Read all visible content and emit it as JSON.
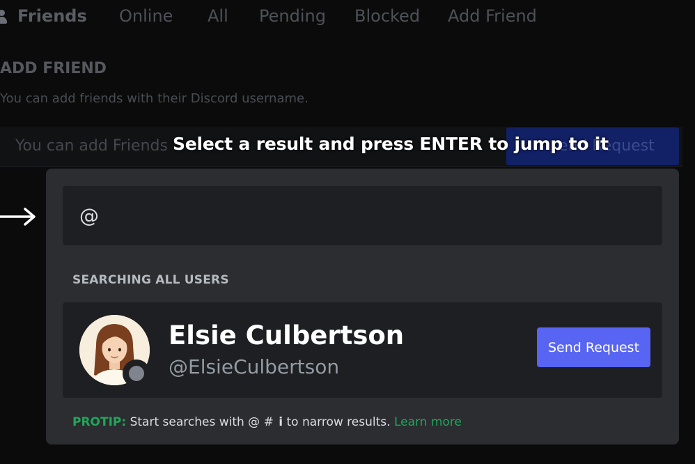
{
  "nav": {
    "title": "Friends",
    "tabs": [
      "Online",
      "All",
      "Pending",
      "Blocked",
      "Add Friend"
    ]
  },
  "add_friend": {
    "title": "ADD FRIEND",
    "description": "You can add friends with their Discord username.",
    "input_placeholder": "You can add Friends",
    "send_label": "end Request"
  },
  "tooltip": "Select a result and press ENTER to jump to it",
  "search": {
    "value": "@",
    "section_label": "SEARCHING ALL USERS"
  },
  "result": {
    "name": "Elsie Culbertson",
    "handle": "@ElsieCulbertson",
    "status": "offline",
    "button_label": "Send Request"
  },
  "protip": {
    "label": "PROTIP:",
    "text": "Start searches with @ #",
    "glyph": "i",
    "text_after": "to narrow results.",
    "link": "Learn more"
  },
  "colors": {
    "accent": "#5865f2",
    "protip_green": "#23a55a",
    "modal_bg": "#2b2d31",
    "input_bg": "#1e1f22",
    "page_bg": "#0b0b0c"
  },
  "icons": [
    "friends-icon",
    "arrow-right-icon",
    "status-offline-icon",
    "info-icon"
  ]
}
